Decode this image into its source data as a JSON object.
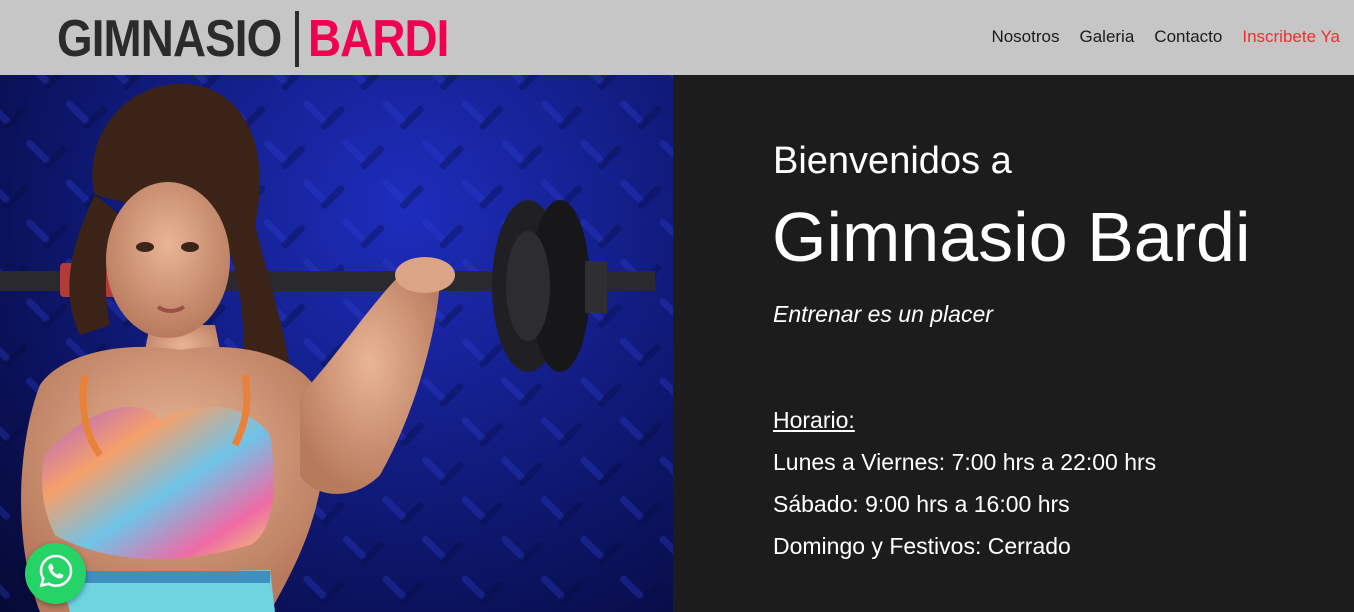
{
  "header": {
    "logo_main": "GIMNASIO",
    "logo_accent": "BARDI",
    "nav": [
      {
        "label": "Nosotros"
      },
      {
        "label": "Galeria"
      },
      {
        "label": "Contacto"
      },
      {
        "label": "Inscribete Ya"
      }
    ]
  },
  "hero": {
    "greeting": "Bienvenidos a",
    "brand": "Gimnasio Bardi",
    "tagline": "Entrenar es un placer",
    "hours_title": "Horario:",
    "hours": [
      "Lunes a Viernes: 7:00 hrs a 22:00 hrs",
      "Sábado: 9:00 hrs a 16:00 hrs",
      "Domingo y Festivos: Cerrado"
    ],
    "photo_alt": "woman-with-barbell-photo"
  },
  "colors": {
    "header_bg": "#c6c6c6",
    "logo_dark": "#2b2b2b",
    "logo_accent": "#f0004f",
    "cta": "#e8322f",
    "panel_bg": "#1c1c1c",
    "whatsapp": "#25d366"
  },
  "floating": {
    "whatsapp_icon": "whatsapp-icon"
  }
}
